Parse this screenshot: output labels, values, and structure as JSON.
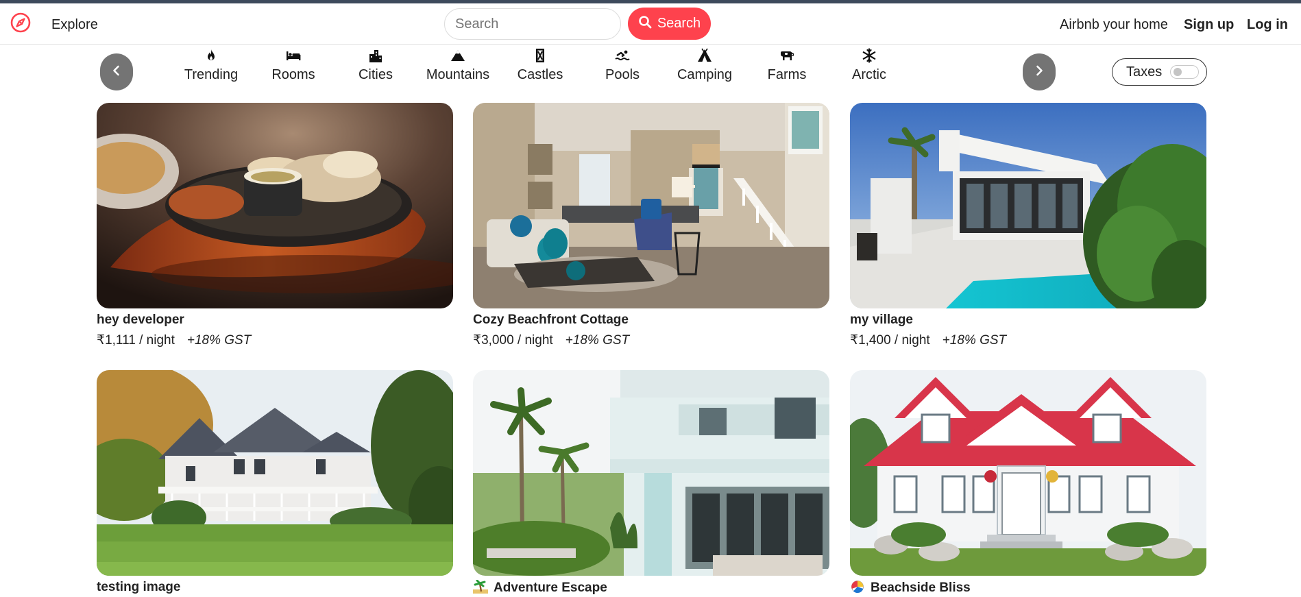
{
  "navbar": {
    "logo_icon": "compass-icon",
    "brand_color": "#fe424d",
    "explore": "Explore",
    "search_placeholder": "Search",
    "search_button": "Search",
    "host_link": "Airbnb your home",
    "signup": "Sign up",
    "login": "Log in"
  },
  "filters": {
    "items": [
      {
        "label": "Trending",
        "icon": "fire-icon"
      },
      {
        "label": "Rooms",
        "icon": "bed-icon"
      },
      {
        "label": "Cities",
        "icon": "city-icon"
      },
      {
        "label": "Mountains",
        "icon": "mountain-icon"
      },
      {
        "label": "Castles",
        "icon": "castle-icon"
      },
      {
        "label": "Pools",
        "icon": "swimmer-icon"
      },
      {
        "label": "Camping",
        "icon": "tent-icon"
      },
      {
        "label": "Farms",
        "icon": "cow-icon"
      },
      {
        "label": "Arctic",
        "icon": "snowflake-icon"
      }
    ],
    "taxes_label": "Taxes",
    "taxes_enabled": false
  },
  "listings": [
    {
      "title": "hey developer",
      "price": "₹1,111 / night",
      "gst": "+18% GST",
      "image": "food-platter-photo"
    },
    {
      "title": "Cozy Beachfront Cottage",
      "price": "₹3,000 / night",
      "gst": "+18% GST",
      "image": "living-room-photo"
    },
    {
      "title": "my village",
      "price": "₹1,400 / night",
      "gst": "+18% GST",
      "image": "modern-villa-pool-photo"
    },
    {
      "title": "testing image",
      "price": "",
      "gst": "",
      "image": "victorian-house-lawn-photo"
    },
    {
      "title": "Adventure Escape",
      "title_icon": "palm-tree-emoji",
      "price": "",
      "gst": "",
      "image": "white-villa-palms-photo"
    },
    {
      "title": "Beachside Bliss",
      "title_icon": "beach-ball-emoji",
      "price": "",
      "gst": "",
      "image": "red-roof-house-photo"
    }
  ]
}
